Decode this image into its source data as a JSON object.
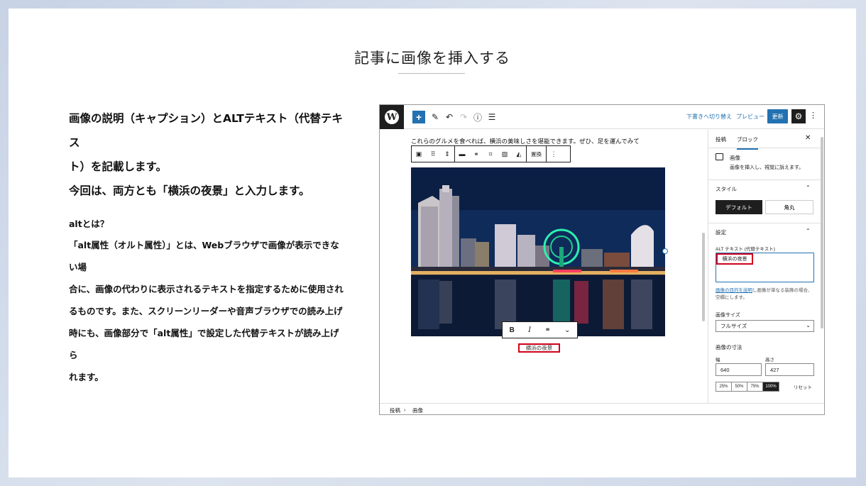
{
  "slide": {
    "title": "記事に画像を挿入する",
    "lead": [
      "画像の説明（キャプション）とALTテキスト（代替テキス",
      "ト）を記載します。",
      "今回は、両方とも「横浜の夜景」と入力します。"
    ],
    "alt_heading": "altとは？",
    "alt_body": [
      "「alt属性（オルト属性）」とは、Webブラウザで画像が表示できない場",
      "合に、画像の代わりに表示されるテキストを指定するために使用され",
      "るものです。また、スクリーンリーダーや音声ブラウザでの読み上げ",
      "時にも、画像部分で「alt属性」で設定した代替テキストが読み上げら",
      "れます。"
    ]
  },
  "editor": {
    "topbar": {
      "save_draft": "下書きへ切り替え",
      "preview": "プレビュー",
      "update": "更新"
    },
    "paragraph_text": "これらのグルメを食べれば、横浜の美味しさを堪能できます。ぜひ、足を運んでみて",
    "block_toolbar": {
      "replace": "置換"
    },
    "caption": "横浜の夜景",
    "sidebar": {
      "tab_post": "投稿",
      "tab_block": "ブロック",
      "block_name": "画像",
      "block_desc": "画像を挿入し、視覚に訴えます。",
      "style_section": "スタイル",
      "style_default": "デフォルト",
      "style_rounded": "角丸",
      "settings_section": "設定",
      "alt_label": "ALT テキスト (代替テキスト)",
      "alt_value": "横浜の夜景",
      "alt_help_link": "画像の目的を説明",
      "alt_help_rest": "し画像が単なる装飾の場合、空欄にします。",
      "image_size_label": "画像サイズ",
      "image_size_value": "フルサイズ",
      "dimensions_title": "画像の寸法",
      "width_label": "幅",
      "height_label": "高さ",
      "width_value": "640",
      "height_value": "427",
      "percent_options": [
        "25%",
        "50%",
        "75%",
        "100%"
      ],
      "percent_selected": "100%",
      "reset": "リセット"
    },
    "breadcrumb": [
      "投稿",
      "画像"
    ]
  },
  "colors": {
    "accent": "#2271b1",
    "highlight": "#d0021b",
    "dark": "#1e1e1e"
  }
}
